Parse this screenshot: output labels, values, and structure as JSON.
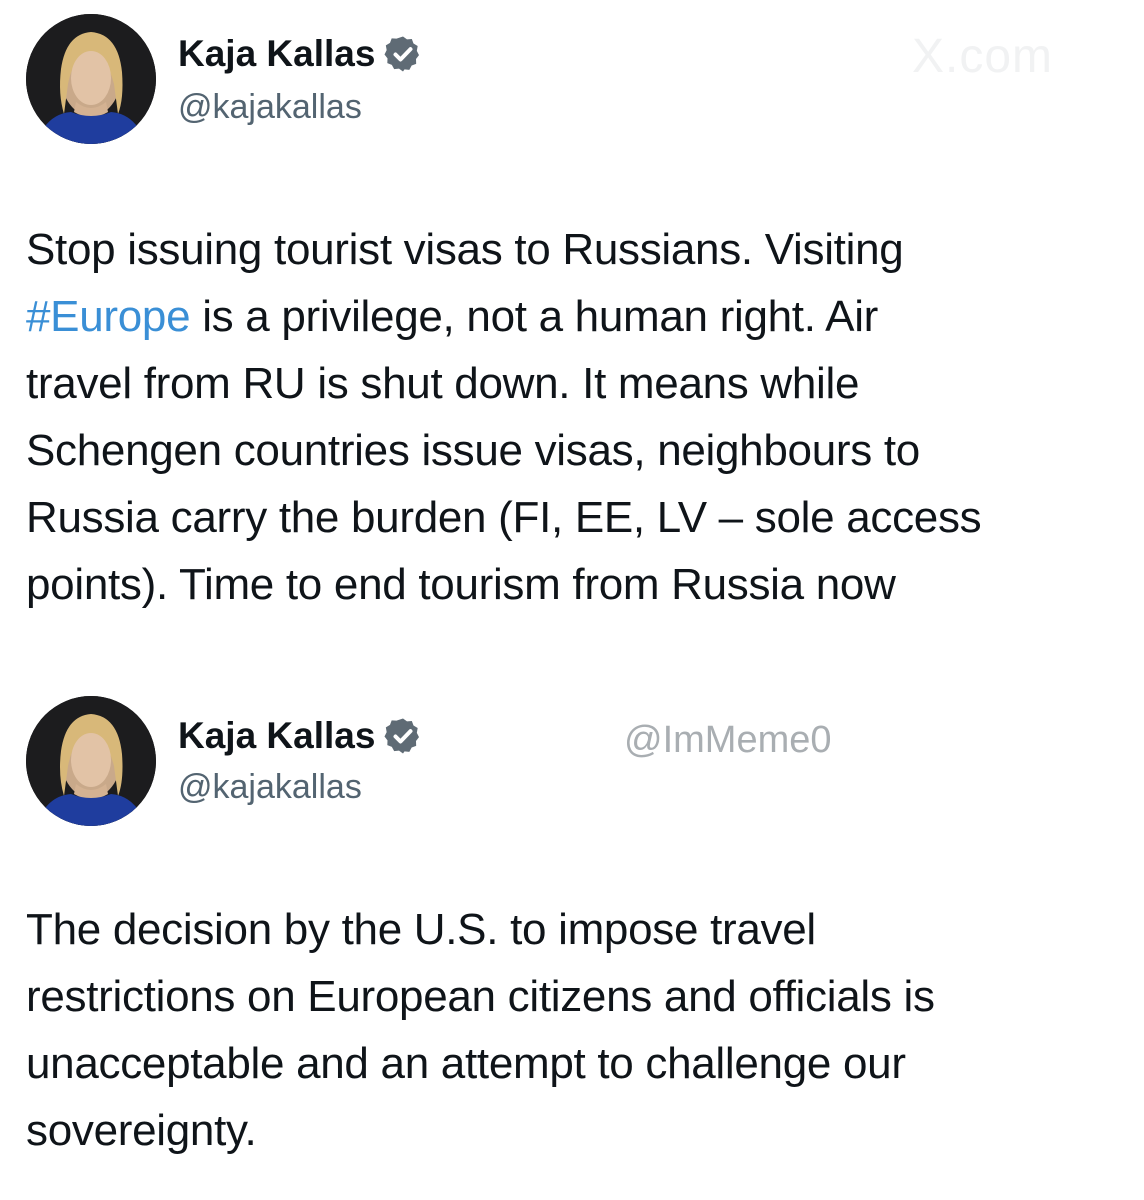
{
  "posts": [
    {
      "author": {
        "name": "Kaja Kallas",
        "handle": "@kajakallas"
      },
      "watermark": "X.com",
      "text_lines": [
        "Stop issuing tourist visas to Russians. Visiting",
        "#Europe",
        " is a privilege, not a human right. Air",
        "travel from RU is shut down. It means while",
        "Schengen countries issue visas, neighbours to",
        "Russia carry the burden (FI, EE, LV – sole access",
        "points). Time to end tourism from Russia now"
      ]
    },
    {
      "author": {
        "name": "Kaja Kallas",
        "handle": "@kajakallas"
      },
      "watermark": "@ImMeme0",
      "text_lines": [
        "The decision by the U.S. to impose travel",
        "restrictions on European citizens and officials is",
        "unacceptable and an attempt to challenge our",
        "sovereignty."
      ]
    }
  ],
  "colors": {
    "hashtag": "#3a8fd6",
    "verified_badge": "#5f6b75",
    "handle": "#536471"
  },
  "icons": {
    "verified": "verified-badge-icon",
    "avatar": "profile-photo"
  }
}
